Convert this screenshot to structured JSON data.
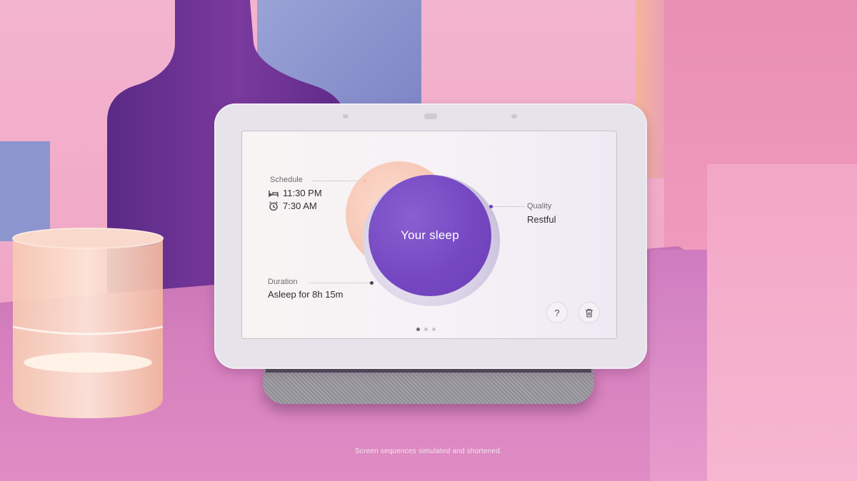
{
  "device": {
    "screen": {
      "schedule": {
        "label": "Schedule",
        "bedtime": "11:30 PM",
        "wake_time": "7:30 AM"
      },
      "duration": {
        "label": "Duration",
        "value": "Asleep for 8h 15m"
      },
      "quality": {
        "label": "Quality",
        "value": "Restful"
      },
      "center_title": "Your sleep",
      "help_button_label": "?",
      "page_indicator": {
        "pages": 3,
        "current": 1
      }
    }
  },
  "caption": "Screen sequences simulated and shortened.",
  "colors": {
    "accent_purple": "#7548c2",
    "background_pink": "#f0a9c6"
  }
}
